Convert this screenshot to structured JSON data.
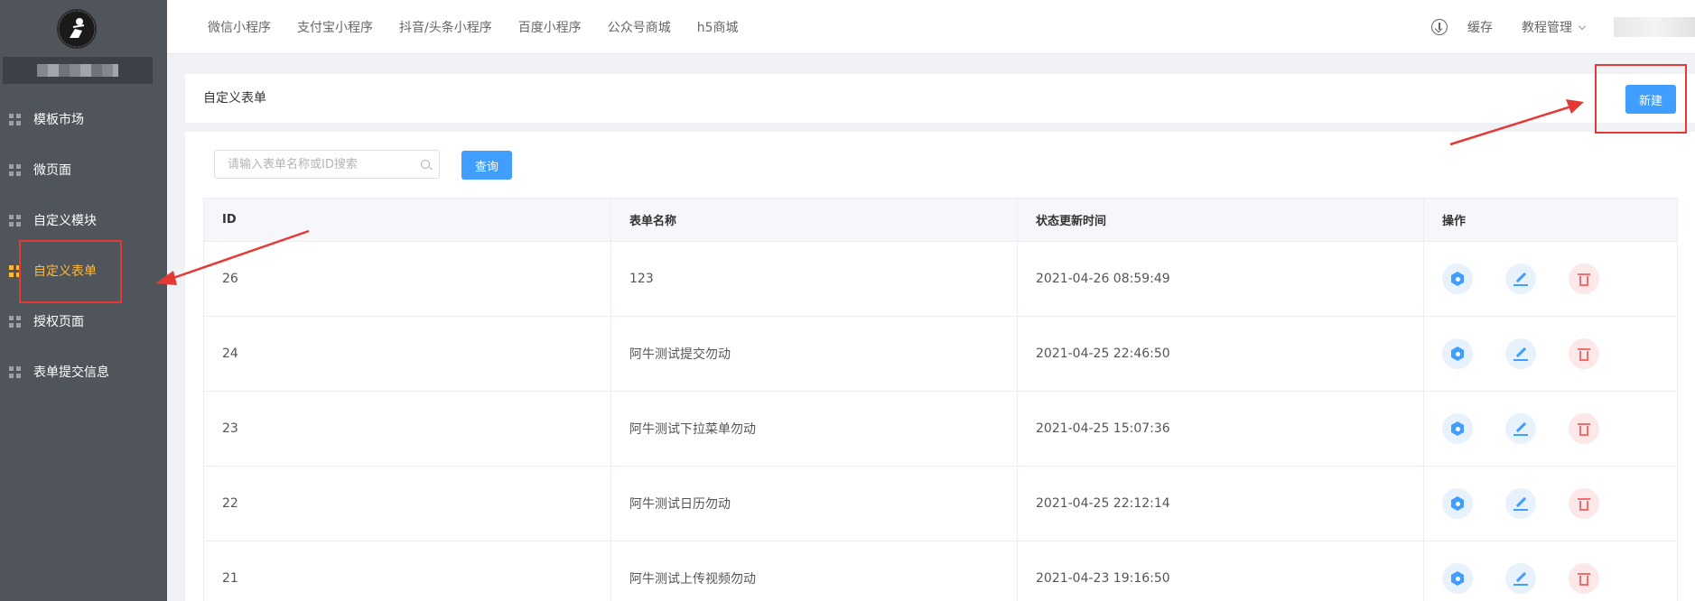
{
  "sidebar": {
    "items": [
      {
        "label": "模板市场",
        "active": false
      },
      {
        "label": "微页面",
        "active": false
      },
      {
        "label": "自定义模块",
        "active": false
      },
      {
        "label": "自定义表单",
        "active": true
      },
      {
        "label": "授权页面",
        "active": false
      },
      {
        "label": "表单提交信息",
        "active": false
      }
    ]
  },
  "topnav": {
    "items": [
      "微信小程序",
      "支付宝小程序",
      "抖音/头条小程序",
      "百度小程序",
      "公众号商城",
      "h5商城"
    ],
    "right": {
      "cache_label": "缓存",
      "tutorial_label": "教程管理"
    }
  },
  "page": {
    "title": "自定义表单",
    "new_button": "新建"
  },
  "search": {
    "placeholder": "请输入表单名称或ID搜索",
    "query_button": "查询"
  },
  "table": {
    "headers": [
      "ID",
      "表单名称",
      "状态更新时间",
      "操作"
    ],
    "rows": [
      {
        "id": "26",
        "name": "123",
        "updated": "2021-04-26 08:59:49"
      },
      {
        "id": "24",
        "name": "阿牛测试提交勿动",
        "updated": "2021-04-25 22:46:50"
      },
      {
        "id": "23",
        "name": "阿牛测试下拉菜单勿动",
        "updated": "2021-04-25 15:07:36"
      },
      {
        "id": "22",
        "name": "阿牛测试日历勿动",
        "updated": "2021-04-25 22:12:14"
      },
      {
        "id": "21",
        "name": "阿牛测试上传视频勿动",
        "updated": "2021-04-23 19:16:50"
      }
    ]
  },
  "colors": {
    "sidebar_bg": "#50555c",
    "active": "#ffb93a",
    "primary": "#409eff",
    "danger": "#f56c6c",
    "annotation": "#e53935"
  },
  "icons": [
    "logo-icon",
    "grid-icon",
    "download-icon",
    "chevron-down-icon",
    "search-icon",
    "settings-hex-icon",
    "edit-icon",
    "delete-icon"
  ]
}
